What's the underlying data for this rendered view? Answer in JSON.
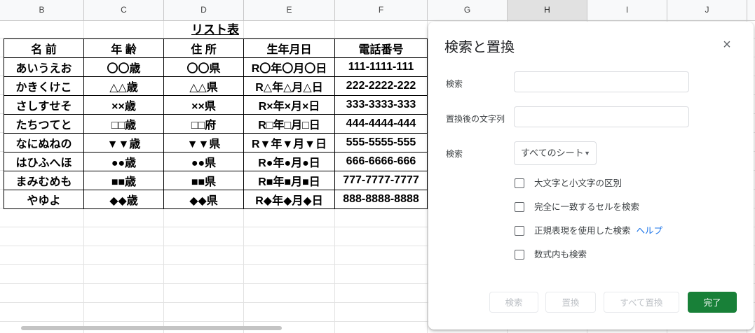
{
  "sheet": {
    "column_headers": [
      "B",
      "C",
      "D",
      "E",
      "F",
      "G",
      "H",
      "I",
      "J"
    ],
    "selected_column": "H",
    "title": "リスト表",
    "table_headers": [
      "名 前",
      "年 齢",
      "住 所",
      "生年月日",
      "電話番号"
    ],
    "rows": [
      [
        "あいうえお",
        "〇〇歳",
        "〇〇県",
        "R〇年〇月〇日",
        "111-1111-111"
      ],
      [
        "かきくけこ",
        "△△歳",
        "△△県",
        "R△年△月△日",
        "222-2222-222"
      ],
      [
        "さしすせそ",
        "××歳",
        "××県",
        "R×年×月×日",
        "333-3333-333"
      ],
      [
        "たちつてと",
        "□□歳",
        "□□府",
        "R□年□月□日",
        "444-4444-444"
      ],
      [
        "なにぬねの",
        "▼▼歳",
        "▼▼県",
        "R▼年▼月▼日",
        "555-5555-555"
      ],
      [
        "はひふへほ",
        "●●歳",
        "●●県",
        "R●年●月●日",
        "666-6666-666"
      ],
      [
        "まみむめも",
        "■■歳",
        "■■県",
        "R■年■月■日",
        "777-7777-7777"
      ],
      [
        "やゆよ",
        "◆◆歳",
        "◆◆県",
        "R◆年◆月◆日",
        "888-8888-8888"
      ]
    ]
  },
  "dialog": {
    "title": "検索と置換",
    "close_icon": "close-icon",
    "find_label": "検索",
    "find_value": "",
    "replace_label": "置換後の文字列",
    "replace_value": "",
    "scope_label": "検索",
    "scope_value": "すべてのシート",
    "options": {
      "match_case": "大文字と小文字の区別",
      "match_entire": "完全に一致するセルを検索",
      "regex": "正規表現を使用した検索",
      "regex_help": "ヘルプ",
      "formulas": "数式内も検索"
    },
    "buttons": {
      "find": "検索",
      "replace": "置換",
      "replace_all": "すべて置換",
      "done": "完了"
    },
    "accent_color": "#188038"
  }
}
